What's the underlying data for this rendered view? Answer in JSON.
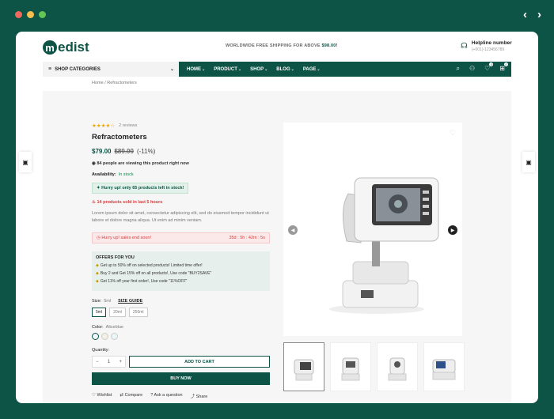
{
  "window": {
    "traffic_colors": [
      "#ee6a5f",
      "#f5be4f",
      "#62c554"
    ],
    "prev_icon": "‹",
    "next_icon": "›"
  },
  "header": {
    "logo_text": "edist",
    "logo_letter": "m",
    "shipping_text": "WORLDWIDE FREE SHIPPING FOR ABOVE ",
    "shipping_amount": "$98.00!",
    "helpline_title": "Helpline number",
    "helpline_number": "(+001)-123456789"
  },
  "nav": {
    "categories_label": "SHOP CATEGORIES",
    "menu": [
      {
        "label": "HOME"
      },
      {
        "label": "PRODUCT"
      },
      {
        "label": "SHOP"
      },
      {
        "label": "BLOG"
      },
      {
        "label": "PAGE"
      }
    ],
    "wishlist_count": "0",
    "cart_count": "0"
  },
  "breadcrumb": "Home / Refractometers",
  "product": {
    "stars": "★★★★☆",
    "reviews": "2 reviews",
    "title": "Refractometers",
    "price_new": "$79.00",
    "price_old": "$89.00",
    "discount": "(-11%)",
    "viewing": "84 people are viewing this product right now",
    "availability_label": "Availability:",
    "availability_value": "In stock",
    "hurry_stock": "Hurry up! only 65 products left in stock!",
    "sold": "14 products sold in last 5 hours",
    "description": "Lorem ipsum dolor sit amet, consectetur adipiscing elit, sed do eiusmod tempor incididunt ut labore et dolore magna aliqua. Ut enim ad minim veniam.",
    "sale_text": "Hurry up! sales end soon!",
    "countdown": "35d : 5h : 42m : 5s",
    "offers_title": "OFFERS FOR YOU",
    "offers": [
      {
        "text": "Get up to 50% off on selected products! Limited time offer!"
      },
      {
        "text": "Buy 2 and Get 15% off on all products!, Use code \"BUY2SAVE\""
      },
      {
        "text": "Get 11% off your first order!, Use code \"11%OFF\""
      }
    ],
    "size_label": "Size:",
    "size_value": "5ml",
    "size_guide": "SIZE GUIDE",
    "sizes": [
      {
        "label": "5ml"
      },
      {
        "label": "20ml"
      },
      {
        "label": "250ml"
      }
    ],
    "color_label": "Color:",
    "color_value": "Aliceblue",
    "colors": [
      "#f0f8ff",
      "#f5f0e6",
      "#eaf6f6"
    ],
    "quantity_label": "Quantity:",
    "quantity": "1",
    "add_to_cart": "ADD TO CART",
    "buy_now": "BUY NOW",
    "actions": [
      {
        "label": "Wishlist"
      },
      {
        "label": "Compare"
      },
      {
        "label": "Ask a question"
      },
      {
        "label": "Share"
      }
    ]
  }
}
